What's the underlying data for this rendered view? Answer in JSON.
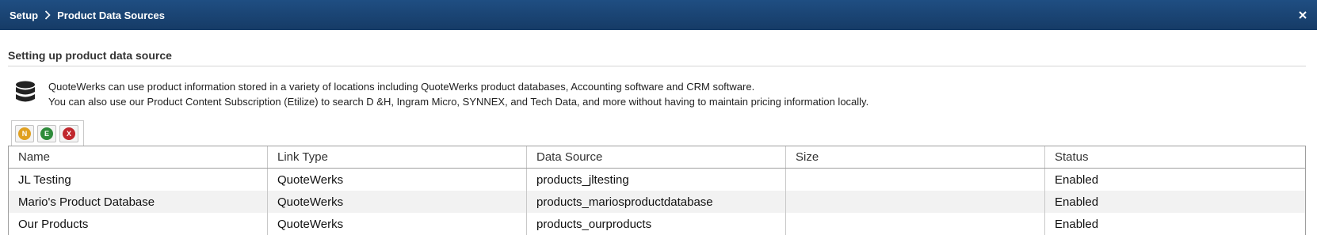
{
  "titlebar": {
    "breadcrumb_root": "Setup",
    "breadcrumb_current": "Product Data Sources",
    "close_icon": "close-icon"
  },
  "section": {
    "title": "Setting up product data source"
  },
  "info": {
    "icon": "database-icon",
    "line1": "QuoteWerks can use product information stored in a variety of locations including QuoteWerks product databases, Accounting software and CRM software.",
    "line2": "You can also use our Product Content Subscription (Etilize) to search D &H, Ingram Micro, SYNNEX, and Tech Data, and more without having to maintain pricing information locally."
  },
  "toolbar": {
    "new_label": "N",
    "edit_label": "E",
    "delete_label": "X",
    "colors": {
      "new": "#e0a020",
      "edit": "#2e8b3a",
      "delete": "#c0272d"
    }
  },
  "grid": {
    "columns": [
      "Name",
      "Link Type",
      "Data Source",
      "Size",
      "Status"
    ],
    "rows": [
      [
        "JL Testing",
        "QuoteWerks",
        "products_jltesting",
        "",
        "Enabled"
      ],
      [
        "Mario's Product Database",
        "QuoteWerks",
        "products_mariosproductdatabase",
        "",
        "Enabled"
      ],
      [
        "Our Products",
        "QuoteWerks",
        "products_ourproducts",
        "",
        "Enabled"
      ]
    ]
  },
  "colors": {
    "titlebar": "#1a4676",
    "header_text": "#ffffff"
  }
}
